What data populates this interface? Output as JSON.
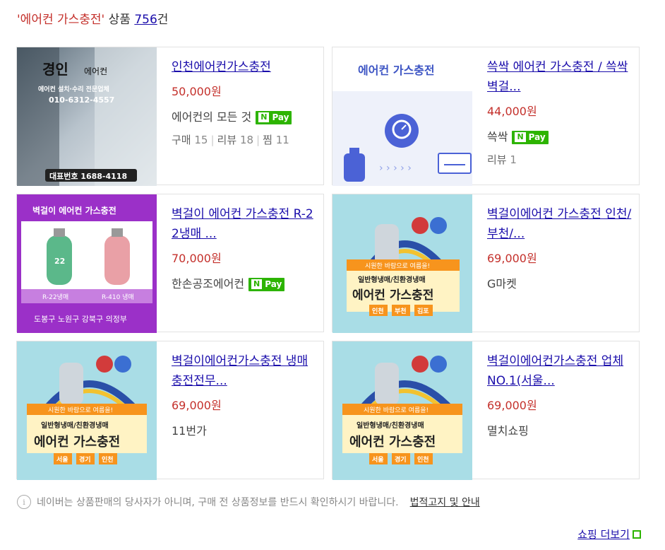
{
  "header": {
    "query": "'에어컨 가스충전'",
    "label": " 상품 ",
    "count": "756",
    "suffix": "건"
  },
  "products": [
    {
      "title": "인천에어컨가스충전",
      "price": "50,000원",
      "seller": "에어컨의 모든 것",
      "npay": true,
      "meta": [
        {
          "label": "구매",
          "value": "15"
        },
        {
          "label": "리뷰",
          "value": "18"
        },
        {
          "label": "찜",
          "value": "11"
        }
      ],
      "thumb_text": [
        "경인",
        "에어컨",
        "에어컨 설치·수리 전문업체",
        "010-6312-4557",
        "대표번호 1688-4118"
      ]
    },
    {
      "title": "쓱싹 에어컨 가스충전 / 쓱싹 벽걸...",
      "price": "44,000원",
      "seller": "쓱싹",
      "npay": true,
      "meta": [
        {
          "label": "리뷰",
          "value": "1"
        }
      ],
      "thumb_text": [
        "에어컨 가스충전"
      ]
    },
    {
      "title": "벽걸이 에어컨 가스충전 R-22냉매 ...",
      "price": "70,000원",
      "seller": "한손공조에어컨",
      "npay": true,
      "meta": [],
      "thumb_text": [
        "벽걸이 에어컨 가스충전",
        "22",
        "R-22냉매",
        "R-410 냉매",
        "도봉구 노원구 강북구 의정부"
      ]
    },
    {
      "title": "벽걸이에어컨 가스충전 인천/부천/...",
      "price": "69,000원",
      "seller": "G마켓",
      "npay": false,
      "meta": [],
      "thumb_text": [
        "시원한 바람으로 여름을!",
        "일반형냉매/친환경냉매",
        "에어컨 가스충전",
        "인천",
        "부천",
        "김포"
      ]
    },
    {
      "title": "벽걸이에어컨가스충전 냉매충전전무...",
      "price": "69,000원",
      "seller": "11번가",
      "npay": false,
      "meta": [],
      "thumb_text": [
        "시원한 바람으로 여름을!",
        "일반형냉매/친환경냉매",
        "에어컨 가스충전",
        "서울",
        "경기",
        "인천"
      ]
    },
    {
      "title": "벽걸이에어컨가스충전 업체NO.1(서울...",
      "price": "69,000원",
      "seller": "멸치쇼핑",
      "npay": false,
      "meta": [],
      "thumb_text": [
        "시원한 바람으로 여름을!",
        "일반형냉매/친환경냉매",
        "에어컨 가스충전",
        "서울",
        "경기",
        "인천"
      ]
    }
  ],
  "npay_label": "Pay",
  "npay_n": "N",
  "footer": {
    "note": "네이버는 상품판매의 당사자가 아니며, 구매 전 상품정보를 반드시 확인하시기 바랍니다.",
    "note_link": "법적고지 및 안내",
    "more": "쇼핑 더보기"
  },
  "colors": {
    "price": "#c4302b",
    "link": "#1a0dab",
    "npay": "#2db400"
  }
}
